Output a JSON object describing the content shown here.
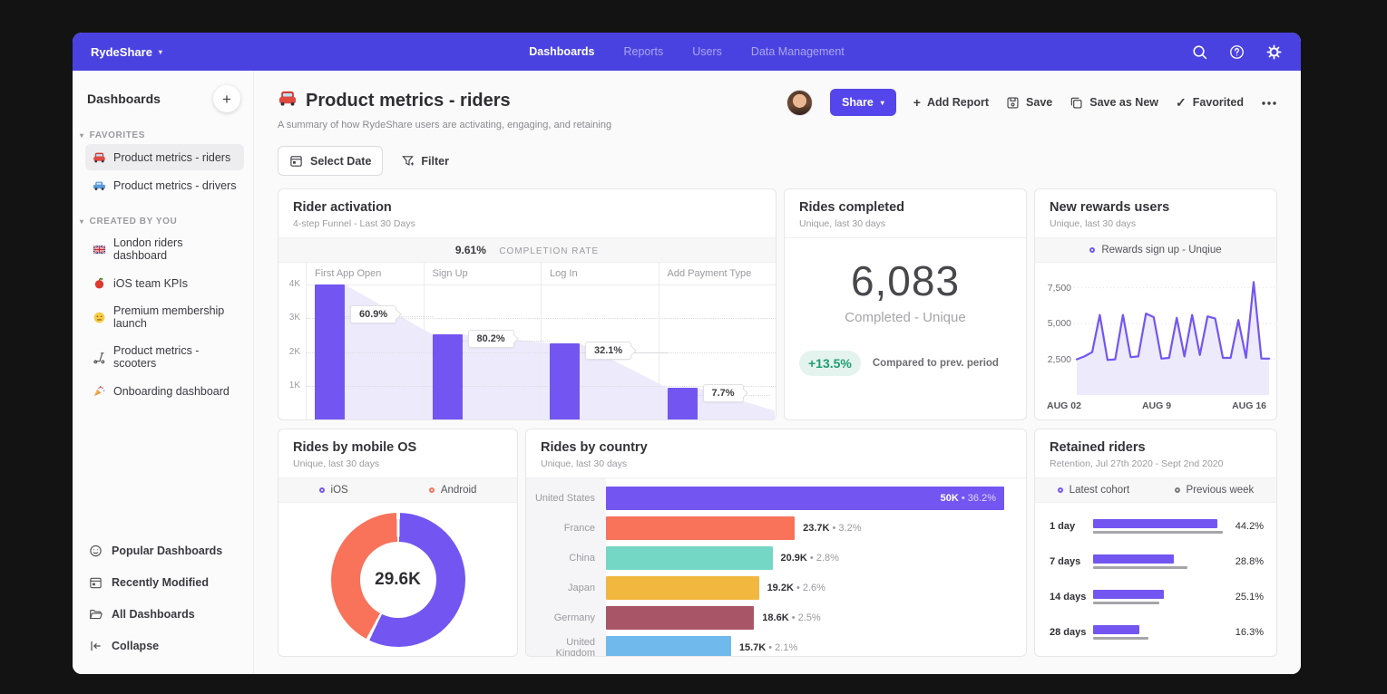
{
  "colors": {
    "nav_purple": "#4a42e0",
    "accent_purple": "#7356f1",
    "accent_fill": "#edeafc",
    "share_purple": "#5446ea",
    "coral": "#f9725a",
    "teal": "#74d7c5",
    "amber": "#f2b73f",
    "maroon": "#a85568",
    "sky_blue": "#6fb9ed",
    "green_text": "#1f9e74",
    "green_bg": "#e4f3ed",
    "previous_gray": "#a5a5aa"
  },
  "topnav": {
    "brand": "RydeShare",
    "items": [
      {
        "label": "Dashboards",
        "active": true
      },
      {
        "label": "Reports",
        "active": false
      },
      {
        "label": "Users",
        "active": false
      },
      {
        "label": "Data Management",
        "active": false
      }
    ]
  },
  "sidebar": {
    "title": "Dashboards",
    "sections": [
      {
        "label": "FAVORITES",
        "items": [
          {
            "icon": "red-car",
            "label": "Product metrics - riders",
            "active": true
          },
          {
            "icon": "blue-car",
            "label": "Product metrics - drivers",
            "active": false
          }
        ]
      },
      {
        "label": "CREATED BY YOU",
        "items": [
          {
            "icon": "uk-flag",
            "label": "London riders dashboard",
            "active": false
          },
          {
            "icon": "apple",
            "label": "iOS team KPIs",
            "active": false
          },
          {
            "icon": "neutral-face",
            "label": "Premium membership launch",
            "active": false
          },
          {
            "icon": "kick-scooter",
            "label": "Product metrics - scooters",
            "active": false
          },
          {
            "icon": "party-popper",
            "label": "Onboarding dashboard",
            "active": false
          }
        ]
      }
    ],
    "footer": [
      {
        "icon": "smiley",
        "label": "Popular Dashboards"
      },
      {
        "icon": "calendar",
        "label": "Recently Modified"
      },
      {
        "icon": "folder",
        "label": "All Dashboards"
      },
      {
        "icon": "collapse",
        "label": "Collapse"
      }
    ]
  },
  "header": {
    "icon": "red-car",
    "title": "Product metrics - riders",
    "subtitle": "A summary of how RydeShare users are activating, engaging, and retaining",
    "actions": {
      "share": "Share",
      "add_report": "Add Report",
      "save": "Save",
      "save_as_new": "Save as New",
      "favorited": "Favorited"
    }
  },
  "toolbar": {
    "select_date": "Select Date",
    "filter": "Filter"
  },
  "cards": {
    "completed": {
      "title": "Rides completed",
      "subtitle": "Unique, last 30 days",
      "value": "6,083",
      "label": "Completed - Unique",
      "delta": "+13.5%",
      "delta_note": "Compared to prev. period"
    }
  },
  "chart_data": [
    {
      "type": "bar",
      "title": "Rider activation",
      "subtitle": "4-step Funnel - Last 30 Days",
      "completion_rate": "9.61%",
      "completion_label": "COMPLETION RATE",
      "steps": [
        "First App Open",
        "Sign Up",
        "Log In",
        "Add Payment Type"
      ],
      "values": [
        4000,
        2520,
        2260,
        940
      ],
      "conversion_labels": [
        "60.9%",
        "80.2%",
        "32.1%",
        "7.7%"
      ],
      "label_positions": [
        3050,
        2330,
        1980,
        730
      ],
      "tail_value": 260,
      "yticks": [
        "4K",
        "3K",
        "2K",
        "1K"
      ],
      "ylim": [
        0,
        4000
      ],
      "grid": true
    },
    {
      "type": "area",
      "title": "New rewards users",
      "subtitle": "Unique, last 30 days",
      "legend": "Rewards sign up - Unqiue",
      "values": [
        2500,
        2700,
        3000,
        5600,
        2450,
        2500,
        5600,
        2650,
        2700,
        5700,
        5450,
        2550,
        2600,
        5400,
        2700,
        5600,
        2800,
        5500,
        5350,
        2600,
        2600,
        5250,
        2600,
        7900,
        2550,
        2550
      ],
      "yticks": [
        2500,
        5000,
        7500
      ],
      "ytick_labels": [
        "2,500",
        "5,000",
        "7,500"
      ],
      "xlabels": [
        "AUG 02",
        "AUG 9",
        "AUG 16"
      ],
      "ymax": 9000,
      "grid": true
    },
    {
      "type": "pie",
      "title": "Rides by mobile OS",
      "subtitle": "Unique, last 30 days",
      "center": "29.6K",
      "slices": [
        {
          "name": "iOS",
          "pct": 57.5,
          "color": "#7356f1"
        },
        {
          "name": "Android",
          "pct": 42.5,
          "color": "#f9725a"
        }
      ]
    },
    {
      "type": "bar",
      "title": "Rides by country",
      "subtitle": "Unique, last 30 days",
      "max": 50000,
      "rows": [
        {
          "country": "United States",
          "value": "50K",
          "pct": "36.2%",
          "num": 50000,
          "color": "#7356f1",
          "label_inside": true
        },
        {
          "country": "France",
          "value": "23.7K",
          "pct": "3.2%",
          "num": 23700,
          "color": "#f9725a",
          "label_inside": false
        },
        {
          "country": "China",
          "value": "20.9K",
          "pct": "2.8%",
          "num": 20900,
          "color": "#74d7c5",
          "label_inside": false
        },
        {
          "country": "Japan",
          "value": "19.2K",
          "pct": "2.6%",
          "num": 19200,
          "color": "#f2b73f",
          "label_inside": false
        },
        {
          "country": "Germany",
          "value": "18.6K",
          "pct": "2.5%",
          "num": 18600,
          "color": "#a85568",
          "label_inside": false
        },
        {
          "country": "United Kingdom",
          "value": "15.7K",
          "pct": "2.1%",
          "num": 15700,
          "color": "#6fb9ed",
          "label_inside": false
        }
      ]
    },
    {
      "type": "bar",
      "title": "Retained riders",
      "subtitle": "Retention, Jul 27th 2020 - Sept 2nd 2020",
      "legend": [
        {
          "label": "Latest cohort",
          "color": "#7356f1"
        },
        {
          "label": "Previous week",
          "color": "#77777c"
        }
      ],
      "scale_max": 47,
      "rows": [
        {
          "label": "1 day",
          "current": 44.2,
          "previous": 46.0,
          "pct": "44.2%"
        },
        {
          "label": "7 days",
          "current": 28.8,
          "previous": 33.5,
          "pct": "28.8%"
        },
        {
          "label": "14 days",
          "current": 25.1,
          "previous": 23.5,
          "pct": "25.1%"
        },
        {
          "label": "28 days",
          "current": 16.3,
          "previous": 19.5,
          "pct": "16.3%"
        }
      ]
    }
  ]
}
